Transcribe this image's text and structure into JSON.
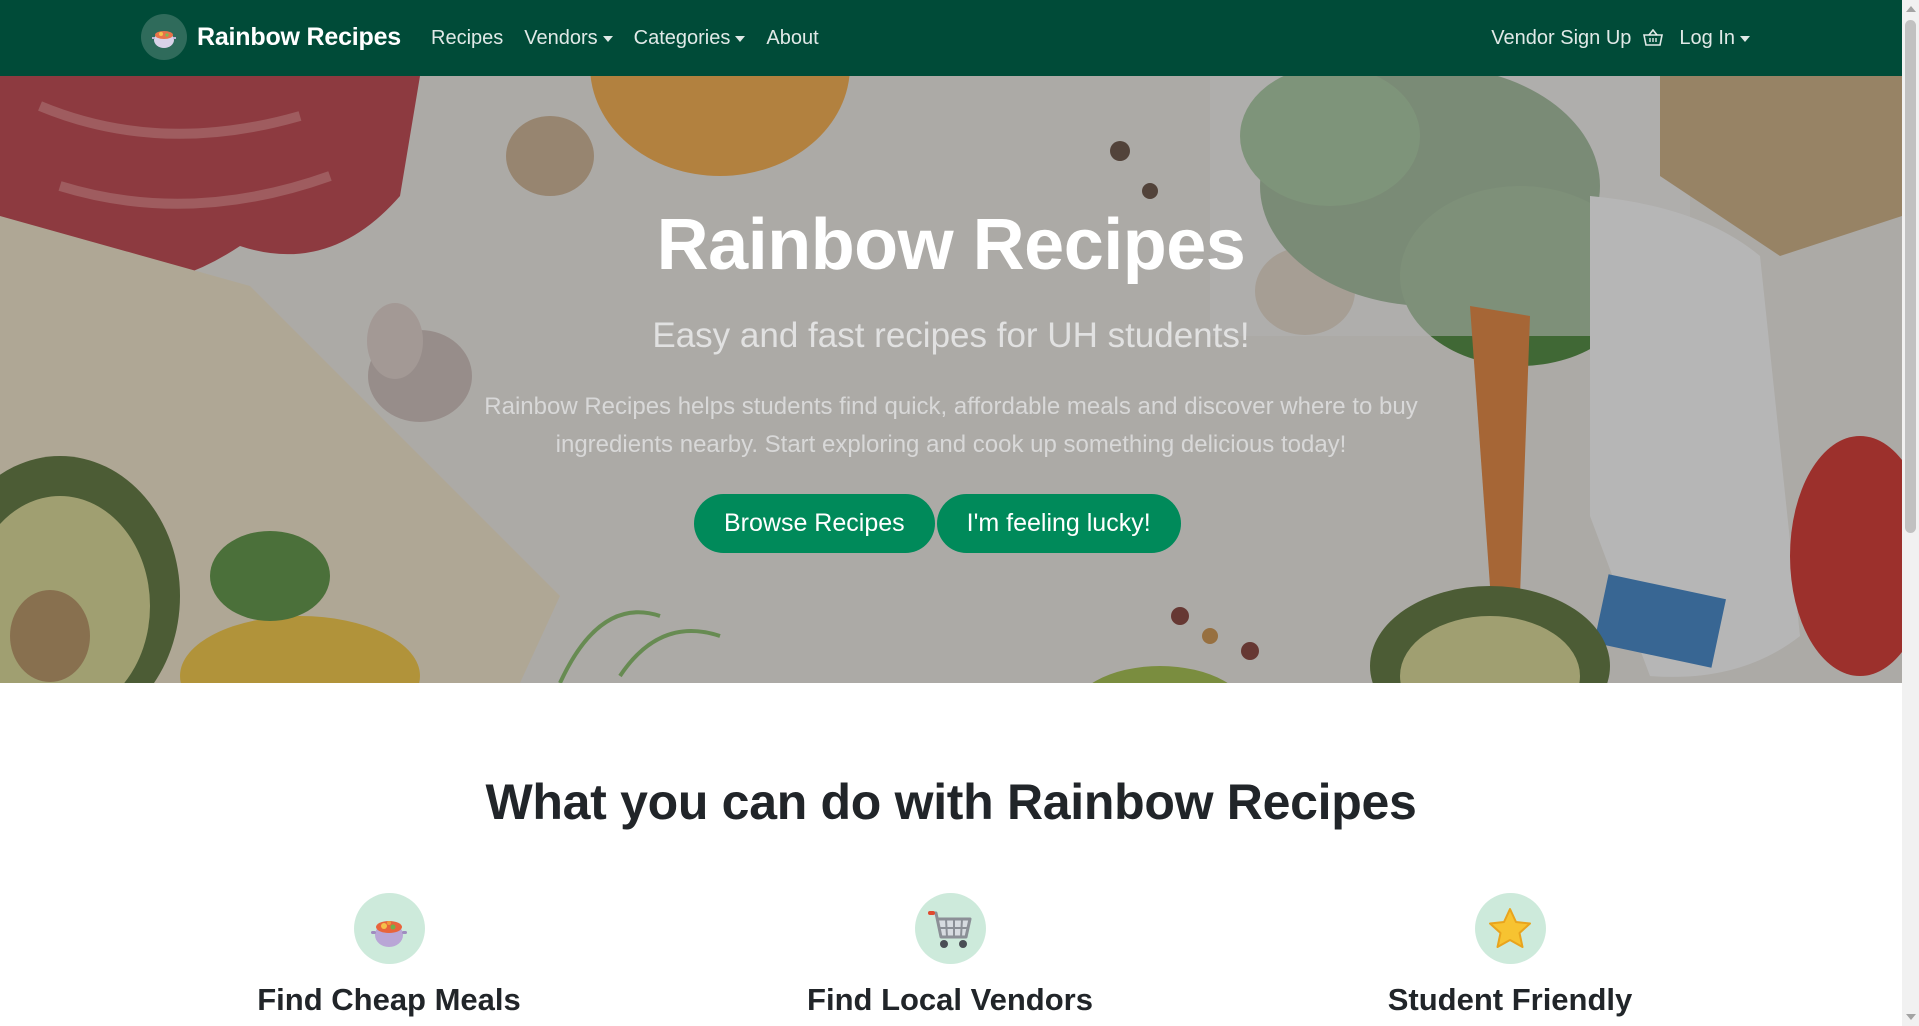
{
  "navbar": {
    "brand": "Rainbow Recipes",
    "links": [
      {
        "label": "Recipes"
      },
      {
        "label": "Vendors"
      },
      {
        "label": "Categories"
      },
      {
        "label": "About"
      }
    ],
    "vendor_signup": "Vendor Sign Up",
    "login": "Log In",
    "background_color": "#004b38"
  },
  "hero": {
    "title": "Rainbow Recipes",
    "subtitle": "Easy and fast recipes for UH students!",
    "description": "Rainbow Recipes helps students find quick, affordable meals and discover where to buy ingredients nearby. Start exploring and cook up something delicious today!",
    "buttons": {
      "browse": "Browse Recipes",
      "lucky": "I'm feeling lucky!"
    },
    "button_color": "#008a5a"
  },
  "features": {
    "title": "What you can do with Rainbow Recipes",
    "items": [
      {
        "title": "Find Cheap Meals",
        "icon": "stew-pot-icon"
      },
      {
        "title": "Find Local Vendors",
        "icon": "shopping-cart-icon"
      },
      {
        "title": "Student Friendly",
        "icon": "star-icon"
      }
    ],
    "icon_background": "#cdeadb"
  }
}
